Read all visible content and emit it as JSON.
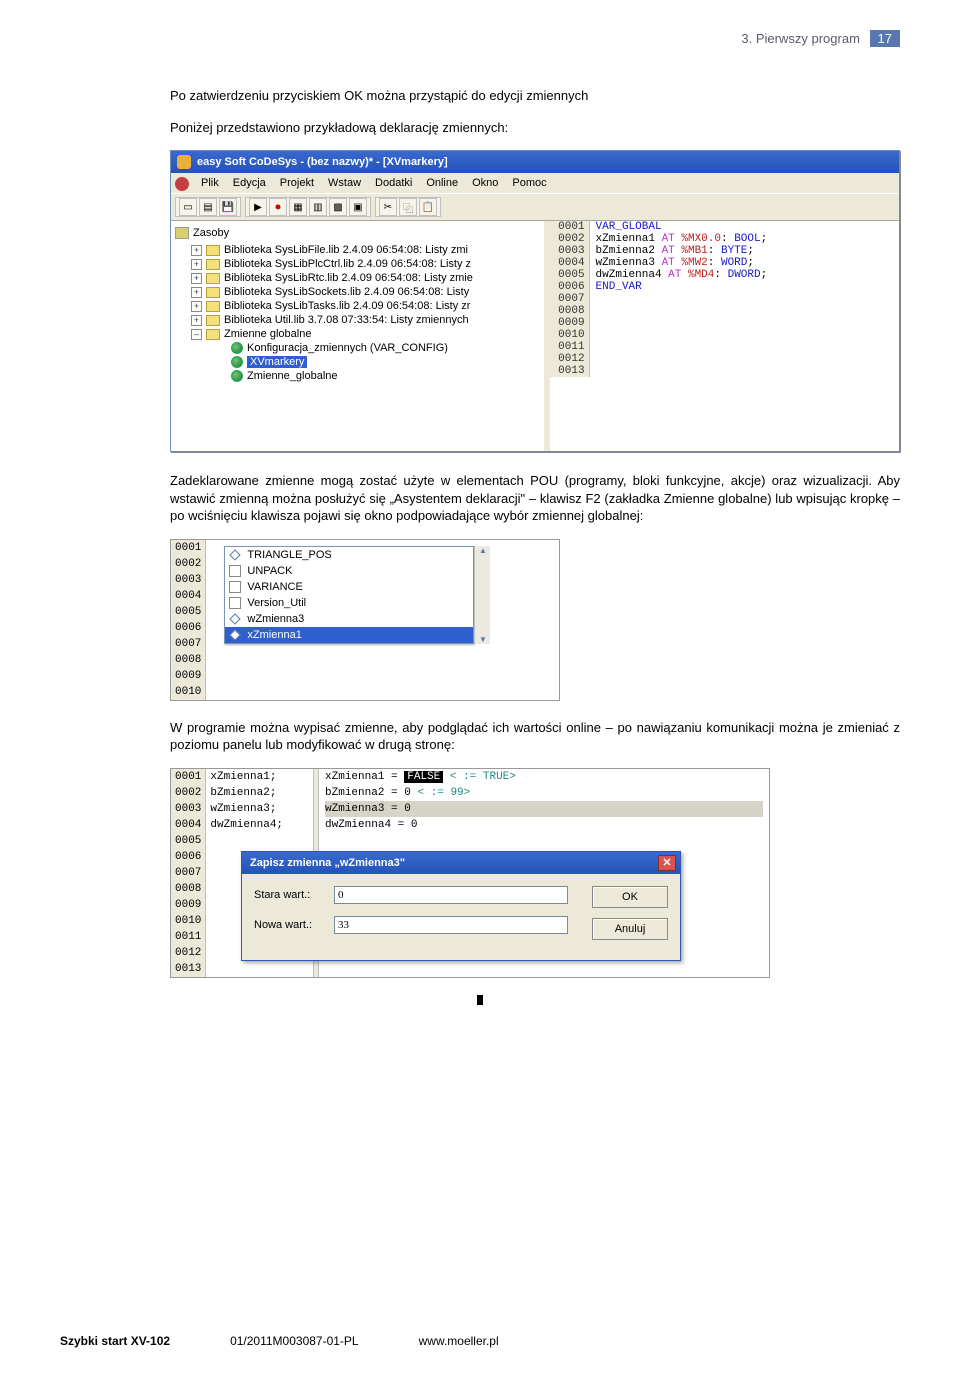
{
  "header": {
    "chapter": "3. Pierwszy program",
    "page_number": "17"
  },
  "para1": "Po zatwierdzeniu przyciskiem OK można przystąpić do edycji zmiennych",
  "para2": "Poniżej przedstawiono przykładową deklarację zmiennych:",
  "para3": "Zadeklarowane zmienne mogą zostać użyte w elementach POU (programy, bloki funkcyjne, akcje) oraz wizualizacji. Aby wstawić zmienną można posłużyć się „Asystentem deklaracji\" – klawisz F2 (zakładka Zmienne globalne) lub wpisując kropkę – po wciśnięciu klawisza pojawi się okno podpowiadające wybór zmiennej globalnej:",
  "para4": "W programie można wypisać zmienne, aby podglądać ich wartości online – po nawiązaniu komunikacji można je zmieniać z poziomu panelu lub modyfikować w drugą stronę:",
  "codesys": {
    "title": "easy Soft CoDeSys - (bez nazwy)* - [XVmarkery]",
    "menu": [
      "Plik",
      "Edycja",
      "Projekt",
      "Wstaw",
      "Dodatki",
      "Online",
      "Okno",
      "Pomoc"
    ],
    "tree_root": "Zasoby",
    "tree": [
      "Biblioteka SysLibFile.lib 2.4.09 06:54:08: Listy zmi",
      "Biblioteka SysLibPlcCtrl.lib 2.4.09 06:54:08: Listy z",
      "Biblioteka SysLibRtc.lib 2.4.09 06:54:08: Listy zmie",
      "Biblioteka SysLibSockets.lib 2.4.09 06:54:08: Listy",
      "Biblioteka SysLibTasks.lib 2.4.09 06:54:08: Listy zr",
      "Biblioteka Util.lib 3.7.08 07:33:54: Listy zmiennych"
    ],
    "tree_globals": "Zmienne globalne",
    "tree_sub": [
      "Konfiguracja_zmiennych (VAR_CONFIG)",
      "XVmarkery",
      "Zmienne_globalne"
    ],
    "code": [
      {
        "ln": "0001",
        "t": "VAR_GLOBAL",
        "cls": "kw-blue"
      },
      {
        "ln": "0002",
        "t": "    xZmienna1 AT %MX0.0: BOOL;",
        "cls": ""
      },
      {
        "ln": "0003",
        "t": "    bZmienna2 AT %MB1: BYTE;",
        "cls": ""
      },
      {
        "ln": "0004",
        "t": "    wZmienna3 AT %MW2: WORD;",
        "cls": ""
      },
      {
        "ln": "0005",
        "t": "    dwZmienna4 AT %MD4: DWORD;",
        "cls": ""
      },
      {
        "ln": "0006",
        "t": "END_VAR",
        "cls": "kw-blue"
      },
      {
        "ln": "0007",
        "t": "",
        "cls": ""
      },
      {
        "ln": "0008",
        "t": "",
        "cls": ""
      },
      {
        "ln": "0009",
        "t": "",
        "cls": ""
      },
      {
        "ln": "0010",
        "t": "",
        "cls": ""
      },
      {
        "ln": "0011",
        "t": "",
        "cls": ""
      },
      {
        "ln": "0012",
        "t": "",
        "cls": ""
      },
      {
        "ln": "0013",
        "t": "",
        "cls": ""
      }
    ]
  },
  "popup": {
    "lines": [
      "0001",
      "0002",
      "0003",
      "0004",
      "0005",
      "0006",
      "0007",
      "0008",
      "0009",
      "0010"
    ],
    "items": [
      {
        "icon": "diamond",
        "label": "TRIANGLE_POS"
      },
      {
        "icon": "doc",
        "label": "UNPACK"
      },
      {
        "icon": "doc",
        "label": "VARIANCE"
      },
      {
        "icon": "doc",
        "label": "Version_Util"
      },
      {
        "icon": "diamond",
        "label": "wZmienna3"
      },
      {
        "icon": "diamond",
        "label": "xZmienna1",
        "selected": true
      }
    ]
  },
  "online": {
    "lines": [
      "0001",
      "0002",
      "0003",
      "0004",
      "0005",
      "0006",
      "0007",
      "0008",
      "0009",
      "0010",
      "0011",
      "0012",
      "0013"
    ],
    "names": [
      "xZmienna1;",
      "bZmienna2;",
      "wZmienna3;",
      "dwZmienna4;"
    ],
    "vals": [
      "xZmienna1 = FALSE < := TRUE>",
      "bZmienna2 = 0 < := 99>",
      "wZmienna3 = 0",
      "dwZmienna4 = 0"
    ]
  },
  "dialog": {
    "title": "Zapisz zmienna „wZmienna3\"",
    "old_label": "Stara wart.:",
    "old_value": "0",
    "new_label": "Nowa wart.:",
    "new_value": "33",
    "ok": "OK",
    "cancel": "Anuluj"
  },
  "footer": {
    "left": "Szybki start XV-102",
    "mid": "01/2011M003087-01-PL",
    "right": "www.moeller.pl"
  }
}
